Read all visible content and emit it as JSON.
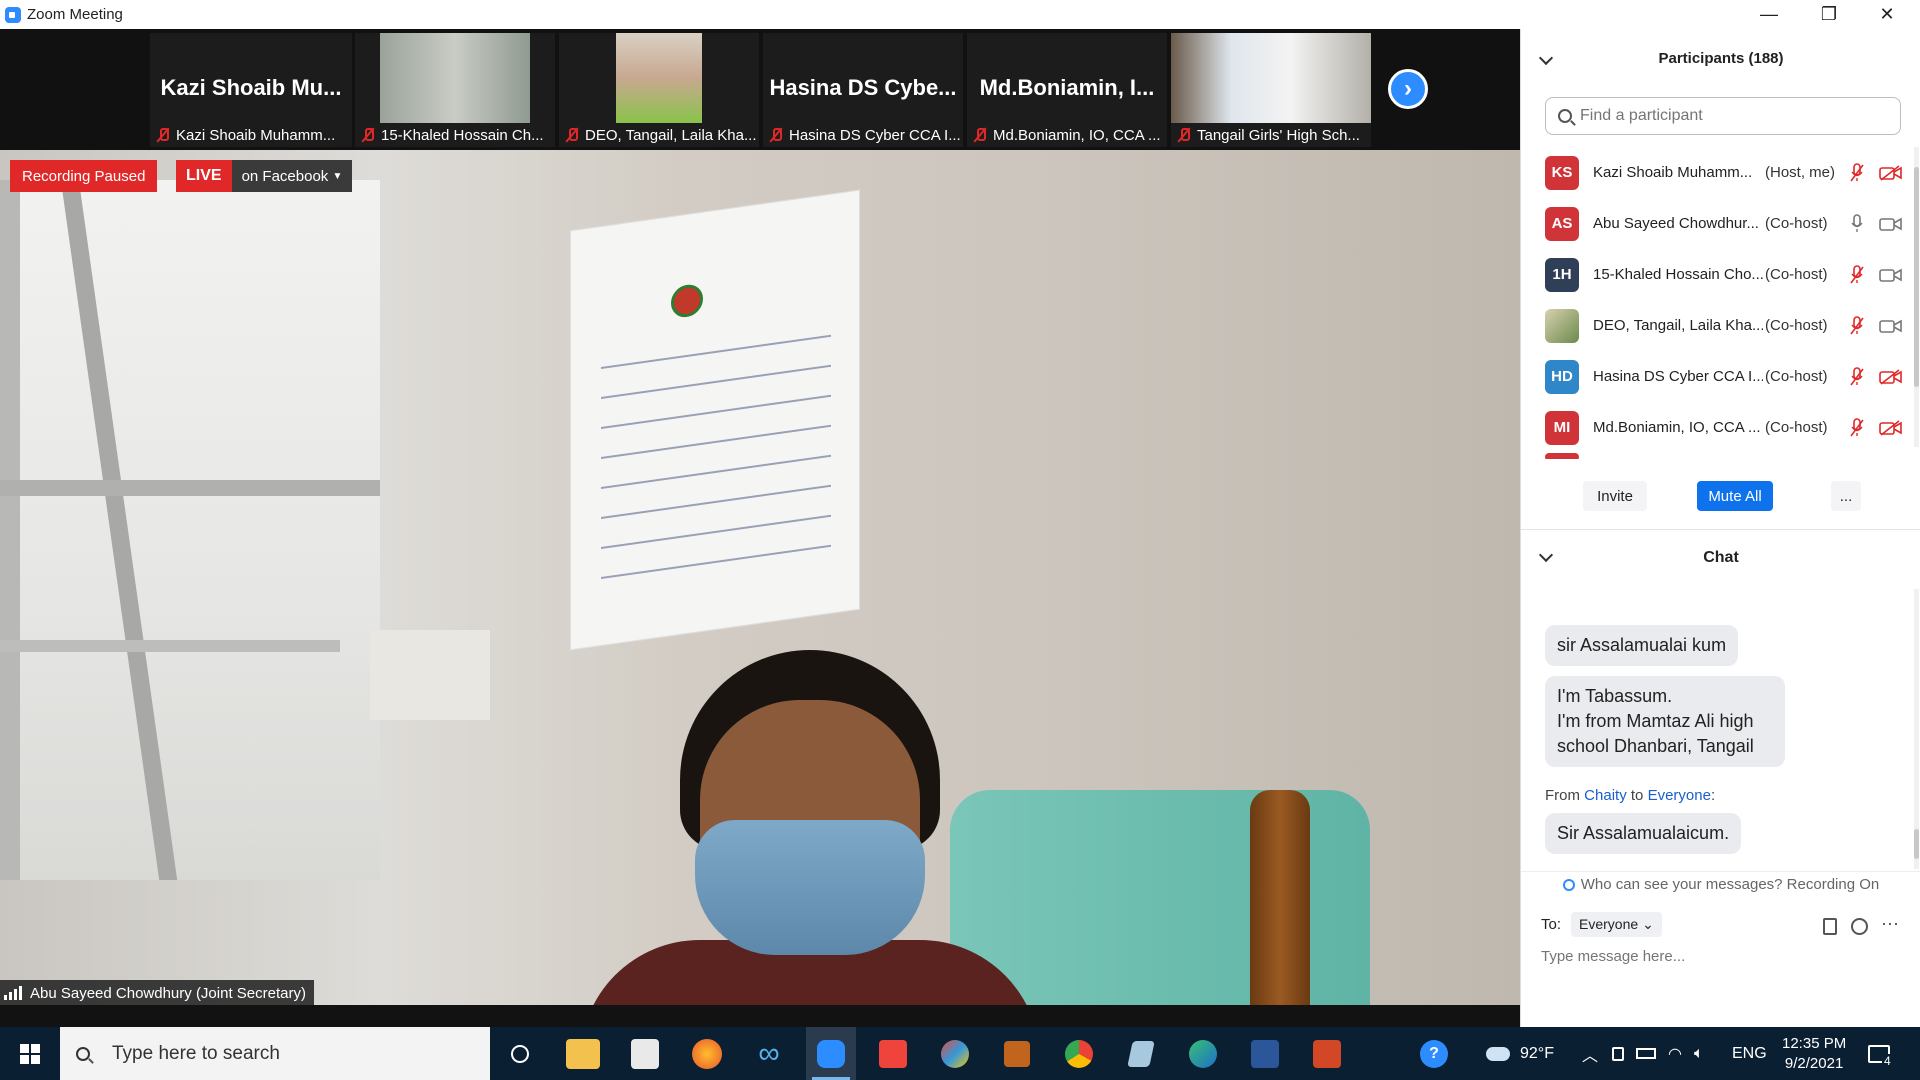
{
  "window": {
    "title": "Zoom Meeting",
    "minimize": "—",
    "restore": "❐",
    "close": "✕"
  },
  "strip": {
    "tiles": [
      {
        "big_name": "Kazi Shoaib Mu...",
        "label": "Kazi Shoaib Muhamm..."
      },
      {
        "big_name": "",
        "label": "15-Khaled Hossain Ch..."
      },
      {
        "big_name": "",
        "label": "DEO, Tangail, Laila Kha..."
      },
      {
        "big_name": "Hasina DS Cybe...",
        "label": "Hasina DS Cyber CCA I..."
      },
      {
        "big_name": "Md.Boniamin, I...",
        "label": "Md.Boniamin, IO, CCA ..."
      },
      {
        "big_name": "",
        "label": "Tangail Girls' High Sch..."
      }
    ],
    "next_icon": "chevron-right-icon"
  },
  "main": {
    "recording": "Recording Paused",
    "live": "LIVE",
    "live_target": "on Facebook",
    "speaker": "Abu Sayeed Chowdhury (Joint Secretary)"
  },
  "participants": {
    "header": "Participants (188)",
    "search_placeholder": "Find a participant",
    "list": [
      {
        "initials": "KS",
        "color": "#d13438",
        "name": "Kazi Shoaib Muhamm...",
        "role": "(Host, me)",
        "mic": "muted",
        "cam": "off"
      },
      {
        "initials": "AS",
        "color": "#d13438",
        "name": "Abu Sayeed Chowdhur...",
        "role": "(Co-host)",
        "mic": "on",
        "cam": "on"
      },
      {
        "initials": "1H",
        "color": "#2e3f57",
        "name": "15-Khaled Hossain Cho...",
        "role": "(Co-host)",
        "mic": "muted",
        "cam": "on"
      },
      {
        "initials": "",
        "color": "#b8c4a0",
        "name": "DEO, Tangail, Laila Kha...",
        "role": "(Co-host)",
        "mic": "muted",
        "cam": "on"
      },
      {
        "initials": "HD",
        "color": "#2f86c9",
        "name": "Hasina DS Cyber CCA I...",
        "role": "(Co-host)",
        "mic": "muted",
        "cam": "off"
      },
      {
        "initials": "MI",
        "color": "#d13438",
        "name": "Md.Boniamin, IO, CCA ...",
        "role": "(Co-host)",
        "mic": "muted",
        "cam": "off"
      }
    ],
    "invite": "Invite",
    "mute_all": "Mute All",
    "more": "..."
  },
  "chat": {
    "header": "Chat",
    "messages": [
      {
        "text": "sir Assalamualai kum"
      },
      {
        "text": "I'm Tabassum.\nI'm from Mamtaz Ali high school  Dhanbari, Tangail"
      },
      {
        "from_prefix": "From ",
        "from_name": "Chaity",
        "to_word": " to ",
        "to_name": "Everyone",
        "colon": ":"
      },
      {
        "text": "Sir Assalamualaicum."
      }
    ],
    "visibility": "Who can see your messages? Recording On",
    "to_label": "To:",
    "to_value": "Everyone",
    "placeholder": "Type message here..."
  },
  "taskbar": {
    "search_placeholder": "Type here to search",
    "weather": "92°F",
    "lang": "ENG",
    "time": "12:35 PM",
    "date": "9/2/2021",
    "notifications": "4",
    "apps": [
      "cortana-icon",
      "file-explorer-icon",
      "store-icon",
      "firefox-icon",
      "infinity-icon",
      "zoom-icon",
      "anydesk-icon",
      "paint-icon",
      "app-icon",
      "chrome-icon",
      "notes-icon",
      "edge-icon",
      "word-icon",
      "powerpoint-icon"
    ]
  }
}
